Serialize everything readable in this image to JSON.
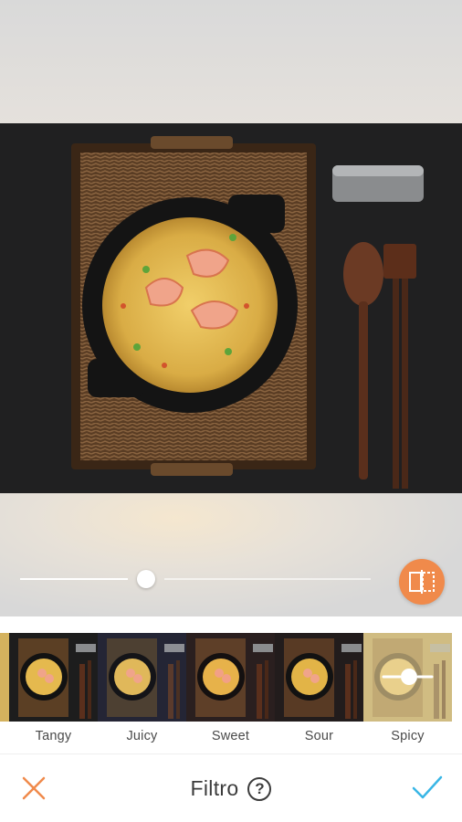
{
  "editor": {
    "title": "Filtro",
    "help_icon_glyph": "?",
    "cancel_icon": "close-icon",
    "confirm_icon": "checkmark-icon",
    "compare_icon": "split-compare-icon",
    "accent_color": "#f08a4b",
    "confirm_color": "#39b6e6",
    "cancel_color": "#f08a4b"
  },
  "intensity_slider": {
    "value_percent": 31
  },
  "filters": [
    {
      "name": "Tangy",
      "selected": false
    },
    {
      "name": "Juicy",
      "selected": false
    },
    {
      "name": "Sweet",
      "selected": false
    },
    {
      "name": "Sour",
      "selected": false
    },
    {
      "name": "Spicy",
      "selected": true
    }
  ]
}
